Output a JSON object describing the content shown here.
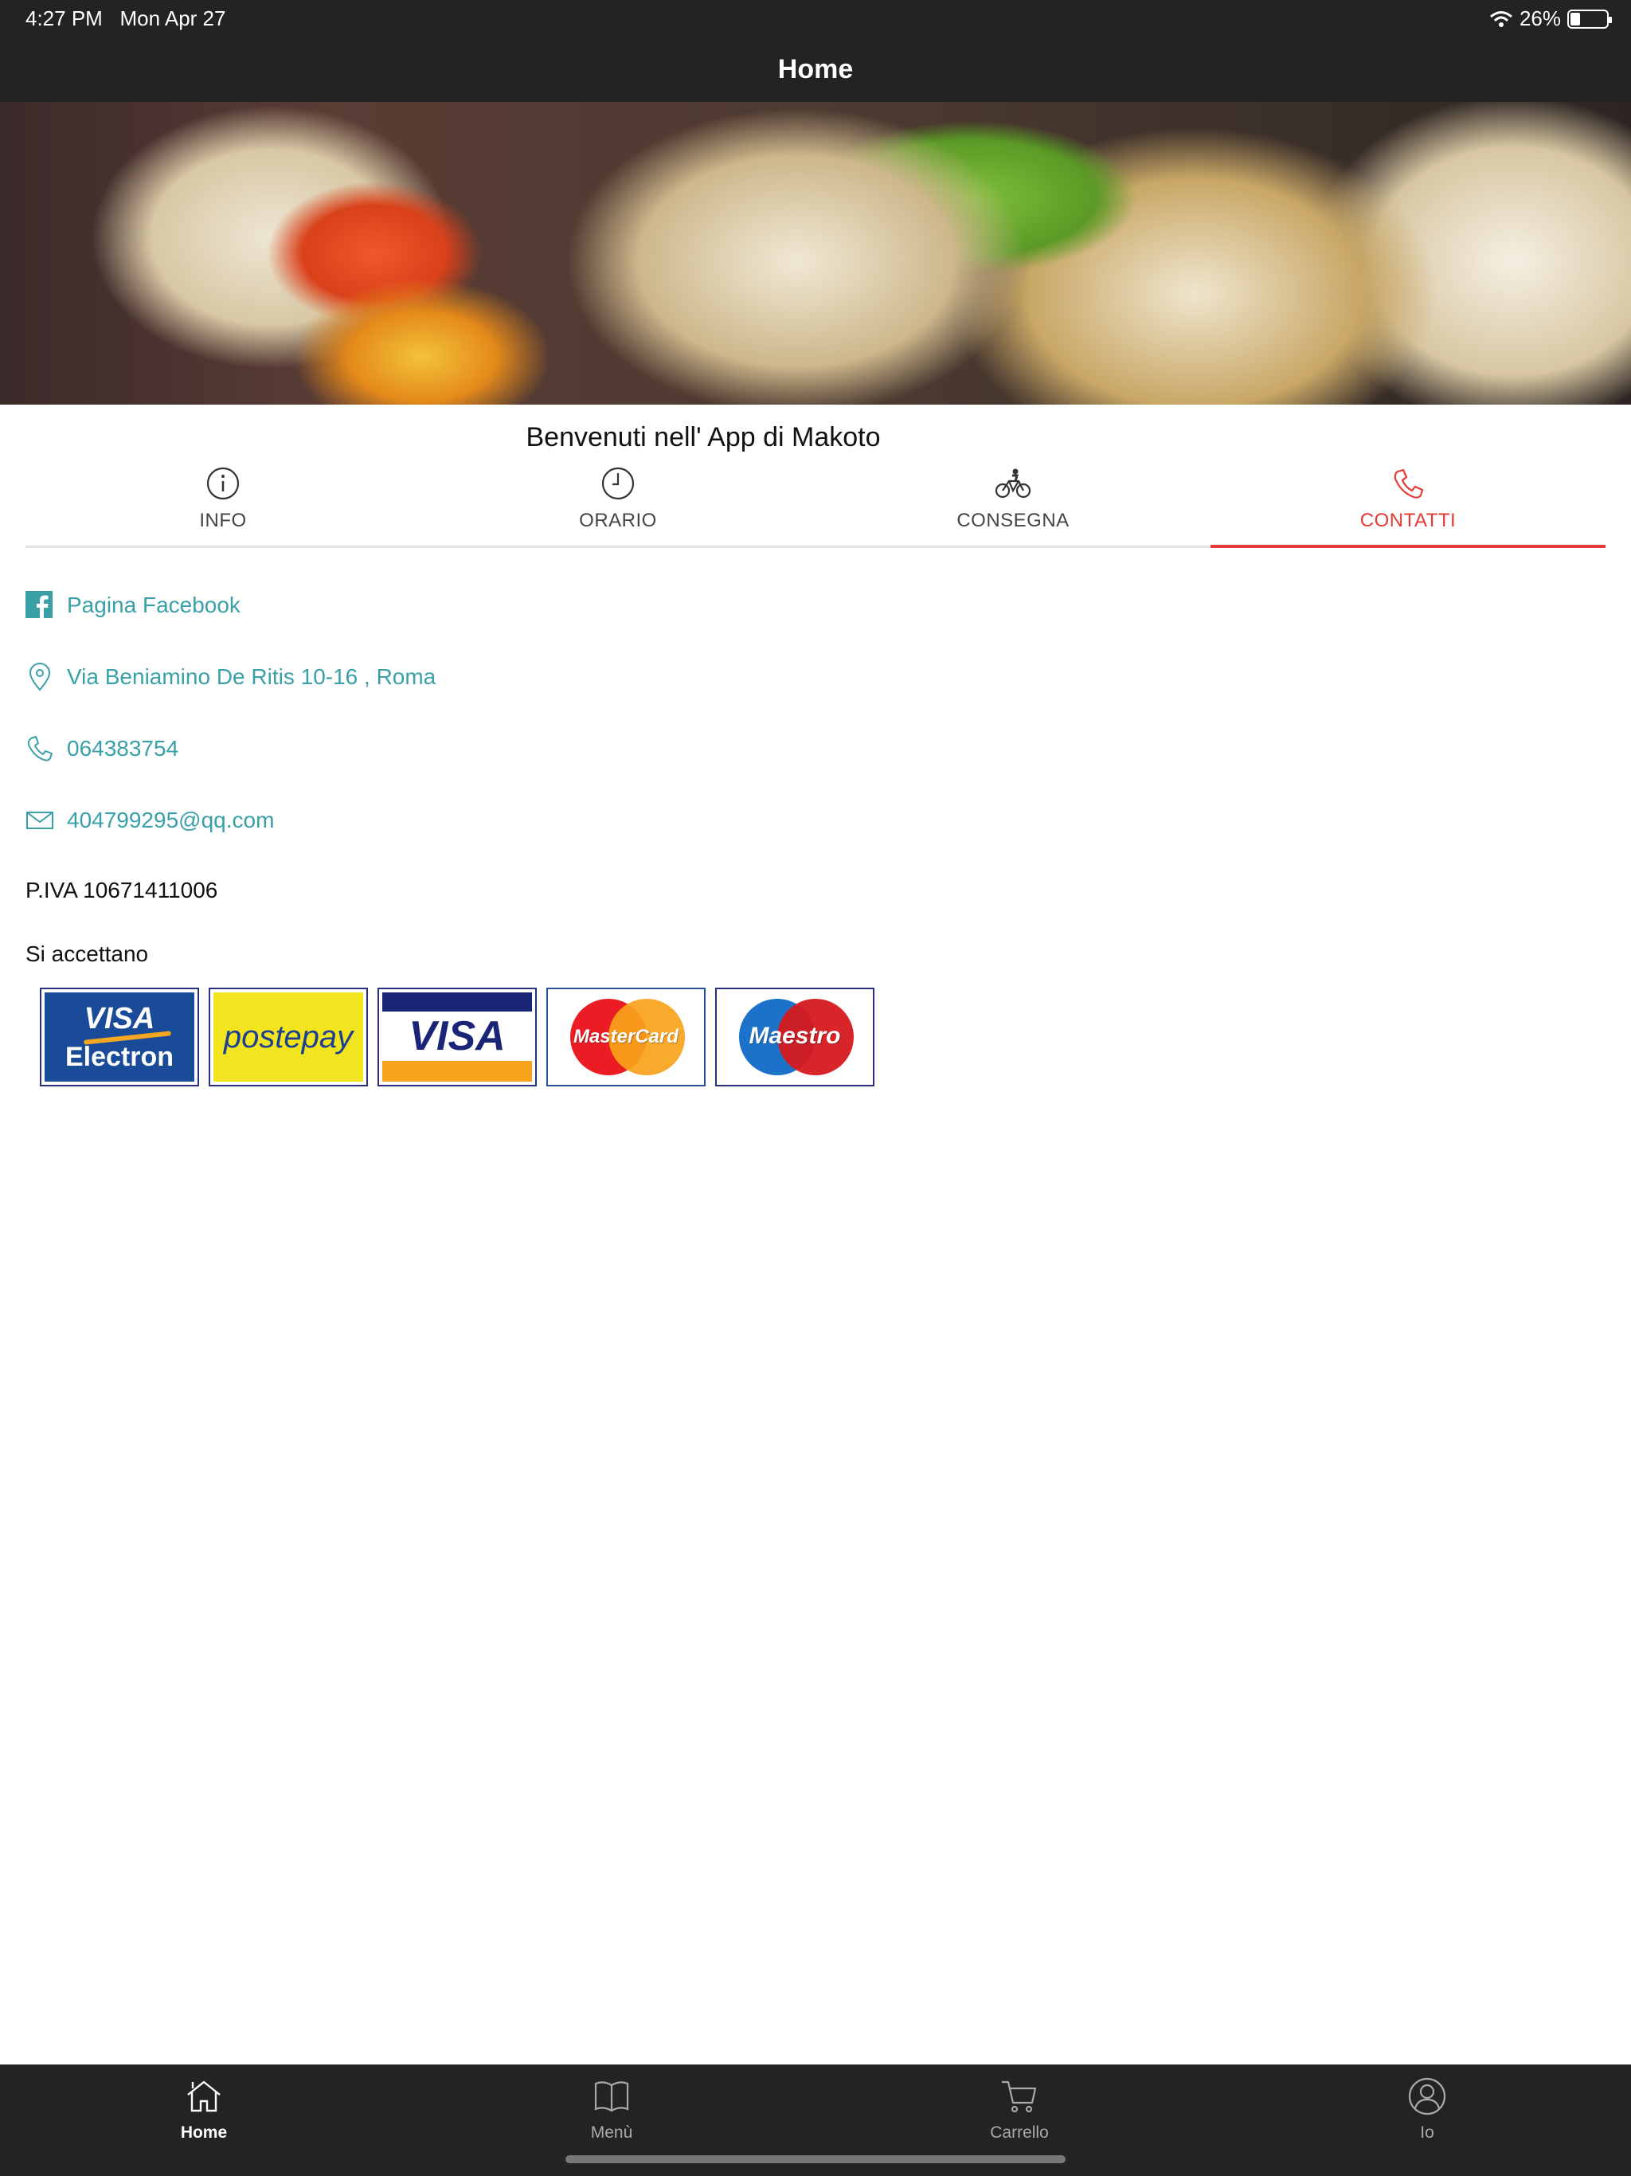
{
  "status_bar": {
    "time": "4:27 PM",
    "date": "Mon Apr 27",
    "battery": "26%",
    "icons": [
      "wifi-icon",
      "battery-icon"
    ]
  },
  "nav": {
    "title": "Home"
  },
  "banner": {
    "slide_count": 3,
    "active_slide": 1
  },
  "welcome": "Benvenuti nell' App di Makoto",
  "tabs": [
    {
      "label": "INFO",
      "icon": "info-icon",
      "active": false
    },
    {
      "label": "ORARIO",
      "icon": "clock-icon",
      "active": false
    },
    {
      "label": "CONSEGNA",
      "icon": "bicycle-icon",
      "active": false
    },
    {
      "label": "CONTATTI",
      "icon": "phone-icon",
      "active": true
    }
  ],
  "contacts": {
    "facebook": "Pagina Facebook",
    "address": "Via Beniamino De Ritis 10-16 , Roma",
    "phone": "064383754",
    "email": "404799295@qq.com"
  },
  "piva": "P.IVA 10671411006",
  "accepted_label": "Si accettano",
  "cards": {
    "visa_electron": {
      "line1": "VISA",
      "line2": "Electron"
    },
    "postepay": "postepay",
    "visa": "VISA",
    "mastercard": "MasterCard",
    "maestro": "Maestro"
  },
  "bottom_tabs": [
    {
      "label": "Home",
      "icon": "home-icon",
      "active": true
    },
    {
      "label": "Menù",
      "icon": "book-icon",
      "active": false
    },
    {
      "label": "Carrello",
      "icon": "cart-icon",
      "active": false
    },
    {
      "label": "Io",
      "icon": "user-icon",
      "active": false
    }
  ],
  "colors": {
    "accent": "#e53935",
    "link": "#3aa0a8",
    "bar_bg": "#232323",
    "dot_active": "#1d6fd6"
  }
}
